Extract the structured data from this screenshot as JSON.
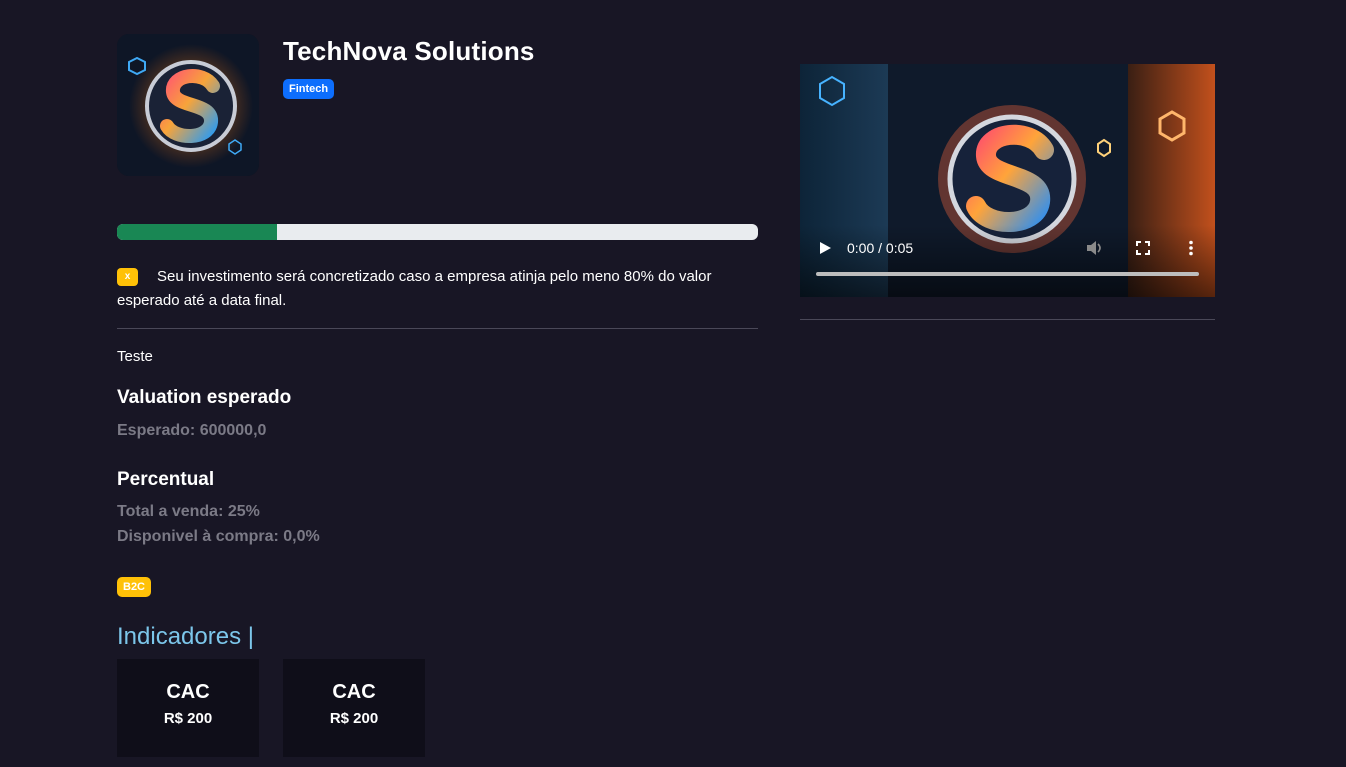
{
  "company": {
    "name": "TechNova Solutions",
    "sector": "Fintech"
  },
  "progress": {
    "fraction": 0.25
  },
  "notice": {
    "icon": "x",
    "text": "Seu investimento será concretizado caso a empresa atinja pelo meno 80% do valor esperado até a data final."
  },
  "description": "Teste",
  "valuation": {
    "title": "Valuation esperado",
    "expected": "Esperado: 600000,0"
  },
  "percentual": {
    "title": "Percentual",
    "total": "Total a venda: 25%",
    "available": "Disponivel à compra: 0,0%"
  },
  "business_model": "B2C",
  "indicators": {
    "title": "Indicadores |",
    "cards": [
      {
        "label": "CAC",
        "value": "R$ 200"
      },
      {
        "label": "CAC",
        "value": "R$ 200"
      }
    ]
  },
  "video": {
    "time": "0:00 / 0:05"
  },
  "colors": {
    "background": "#181625",
    "progress": "#198754",
    "sector_badge": "#0d6efd",
    "model_badge": "#ffc107",
    "indicator_title": "#7cc6ea"
  }
}
